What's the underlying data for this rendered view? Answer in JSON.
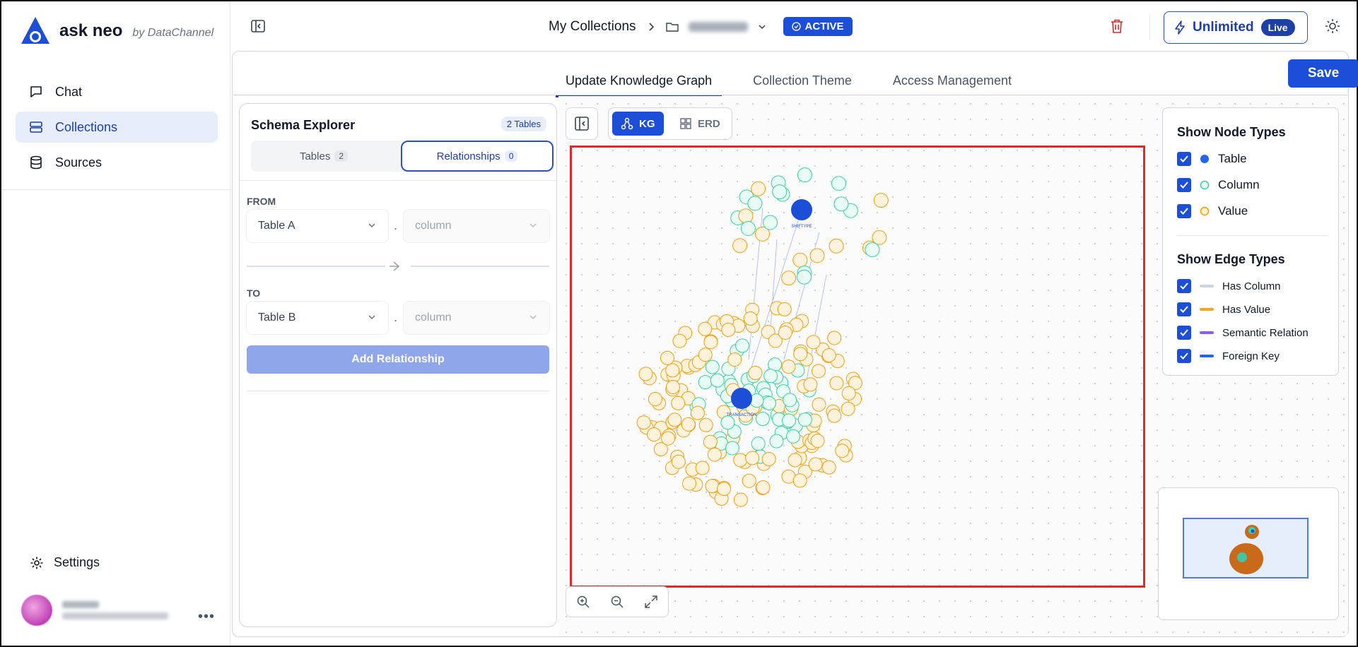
{
  "brand": {
    "name": "ask neo",
    "by": "by DataChannel"
  },
  "sidebar": {
    "items": [
      {
        "label": "Chat",
        "icon": "chat-icon",
        "active": false
      },
      {
        "label": "Collections",
        "icon": "collections-icon",
        "active": true
      },
      {
        "label": "Sources",
        "icon": "database-icon",
        "active": false
      }
    ],
    "settings_label": "Settings"
  },
  "header": {
    "breadcrumb_root": "My Collections",
    "status_badge": "ACTIVE",
    "plan_label": "Unlimited",
    "plan_pill": "Live"
  },
  "tabs": [
    {
      "label": "Update Knowledge Graph",
      "active": true
    },
    {
      "label": "Collection Theme",
      "active": false
    },
    {
      "label": "Access Management",
      "active": false
    }
  ],
  "save_label": "Save",
  "schema": {
    "title": "Schema Explorer",
    "table_count": "2 Tables",
    "tab_tables": "Tables",
    "tab_tables_count": "2",
    "tab_relationships": "Relationships",
    "tab_relationships_count": "0",
    "from_label": "FROM",
    "to_label": "TO",
    "from_table": "Table A",
    "to_table": "Table B",
    "column_placeholder": "column",
    "add_button": "Add Relationship"
  },
  "view_toggle": {
    "kg": "KG",
    "erd": "ERD"
  },
  "filters": {
    "node_title": "Show Node Types",
    "nodes": [
      {
        "label": "Table",
        "color": "#2563eb",
        "checked": true
      },
      {
        "label": "Column",
        "color": "#34d399",
        "checked": true
      },
      {
        "label": "Value",
        "color": "#f59e0b",
        "checked": true
      }
    ],
    "edge_title": "Show Edge Types",
    "edges": [
      {
        "label": "Has Column",
        "color": "#cbd5e1",
        "checked": true
      },
      {
        "label": "Has Value",
        "color": "#f5a524",
        "checked": true
      },
      {
        "label": "Semantic Relation",
        "color": "#8b5cf6",
        "checked": true
      },
      {
        "label": "Foreign Key",
        "color": "#2563eb",
        "checked": true
      }
    ]
  },
  "graph": {
    "table_nodes": [
      {
        "label": "SHIFTYPE"
      },
      {
        "label": "TRANSACTION"
      }
    ]
  },
  "colors": {
    "accent": "#1d4ed8",
    "active_nav_bg": "#e8edfb",
    "value_node": "#f59e0b",
    "column_node": "#34d399",
    "highlight_border": "#d92d2d"
  }
}
